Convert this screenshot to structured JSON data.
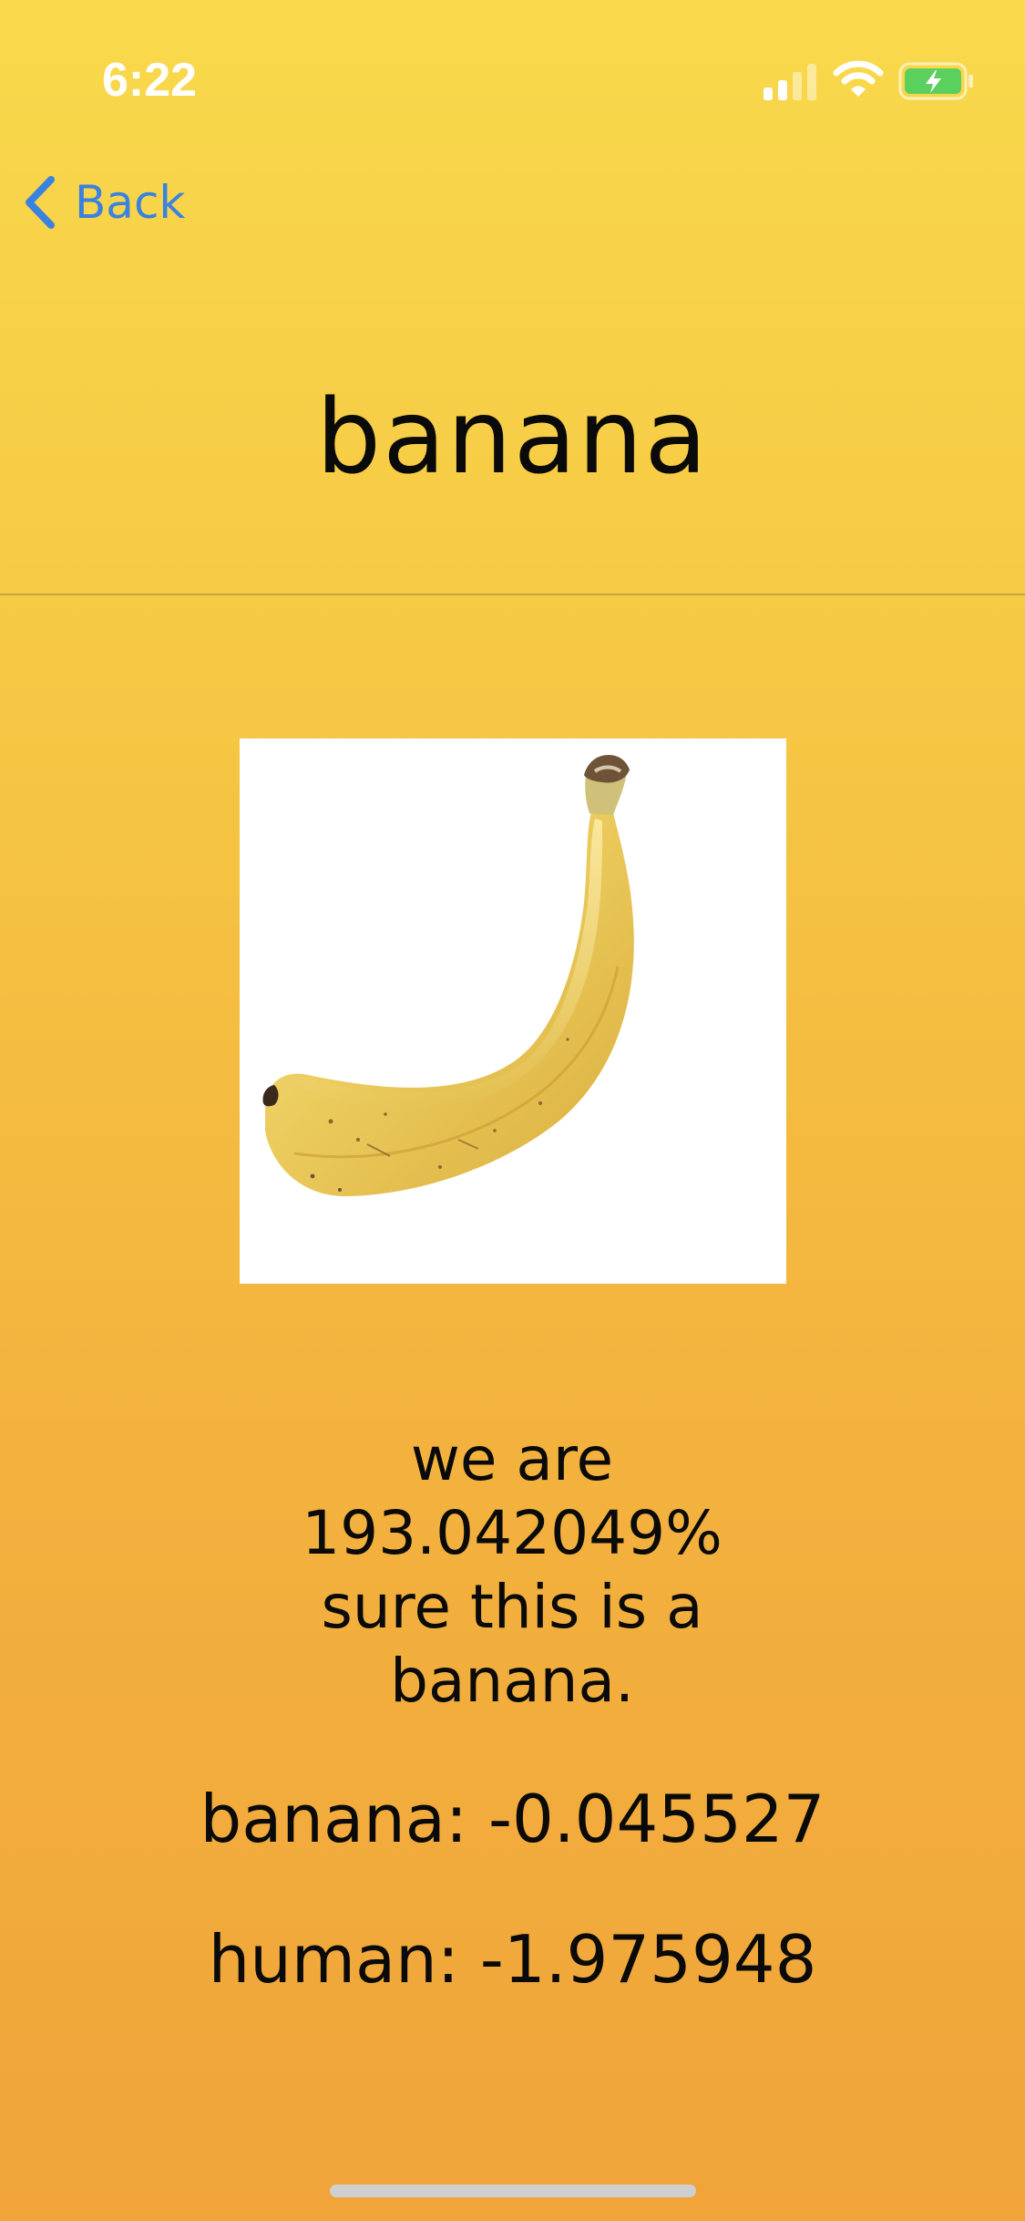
{
  "status_bar": {
    "time": "6:22",
    "icons": [
      "cellular-signal-icon",
      "wifi-icon",
      "battery-charging-icon"
    ],
    "battery_color": "#5CD05E"
  },
  "nav": {
    "back_label": "Back",
    "back_icon": "chevron-left-icon",
    "accent_color": "#3A82E0"
  },
  "title": "banana",
  "image": {
    "subject": "banana-photo",
    "background": "#FFFFFF"
  },
  "result": {
    "lines": [
      "we are",
      "193.042049%",
      "sure this is a",
      "banana."
    ]
  },
  "scores": [
    {
      "label": "banana",
      "value": "-0.045527",
      "text": "banana: -0.045527"
    },
    {
      "label": "human",
      "value": "-1.975948",
      "text": "human: -1.975948"
    }
  ],
  "theme": {
    "gradient_top": "#F9D94C",
    "gradient_bottom": "#F0A43A",
    "text_color": "#0A0A0A"
  }
}
